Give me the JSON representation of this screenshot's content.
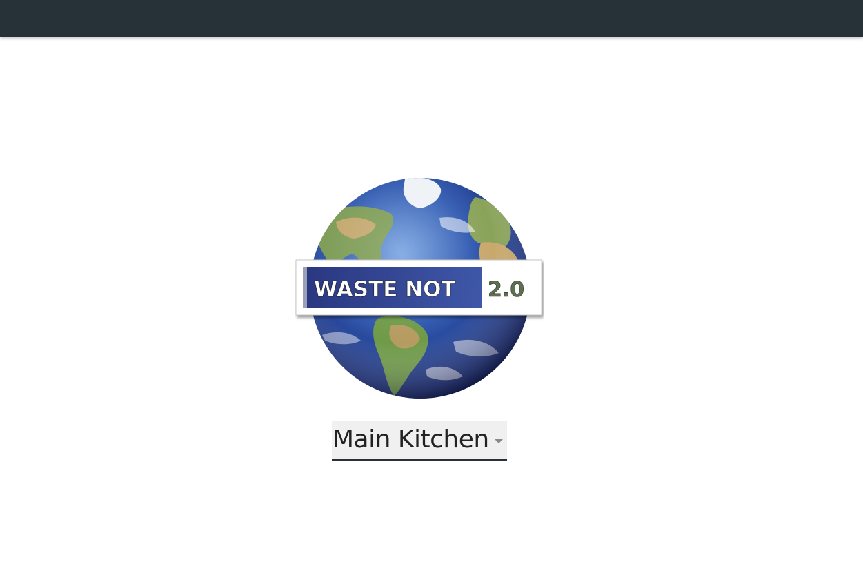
{
  "header": {
    "background_color": "#263238"
  },
  "logo": {
    "main_text": "WASTE NOT",
    "version_text": "2.0",
    "icon": "earth-globe-icon"
  },
  "kitchen_selector": {
    "selected_value": "Main Kitchen",
    "icon": "caret-down-icon"
  }
}
